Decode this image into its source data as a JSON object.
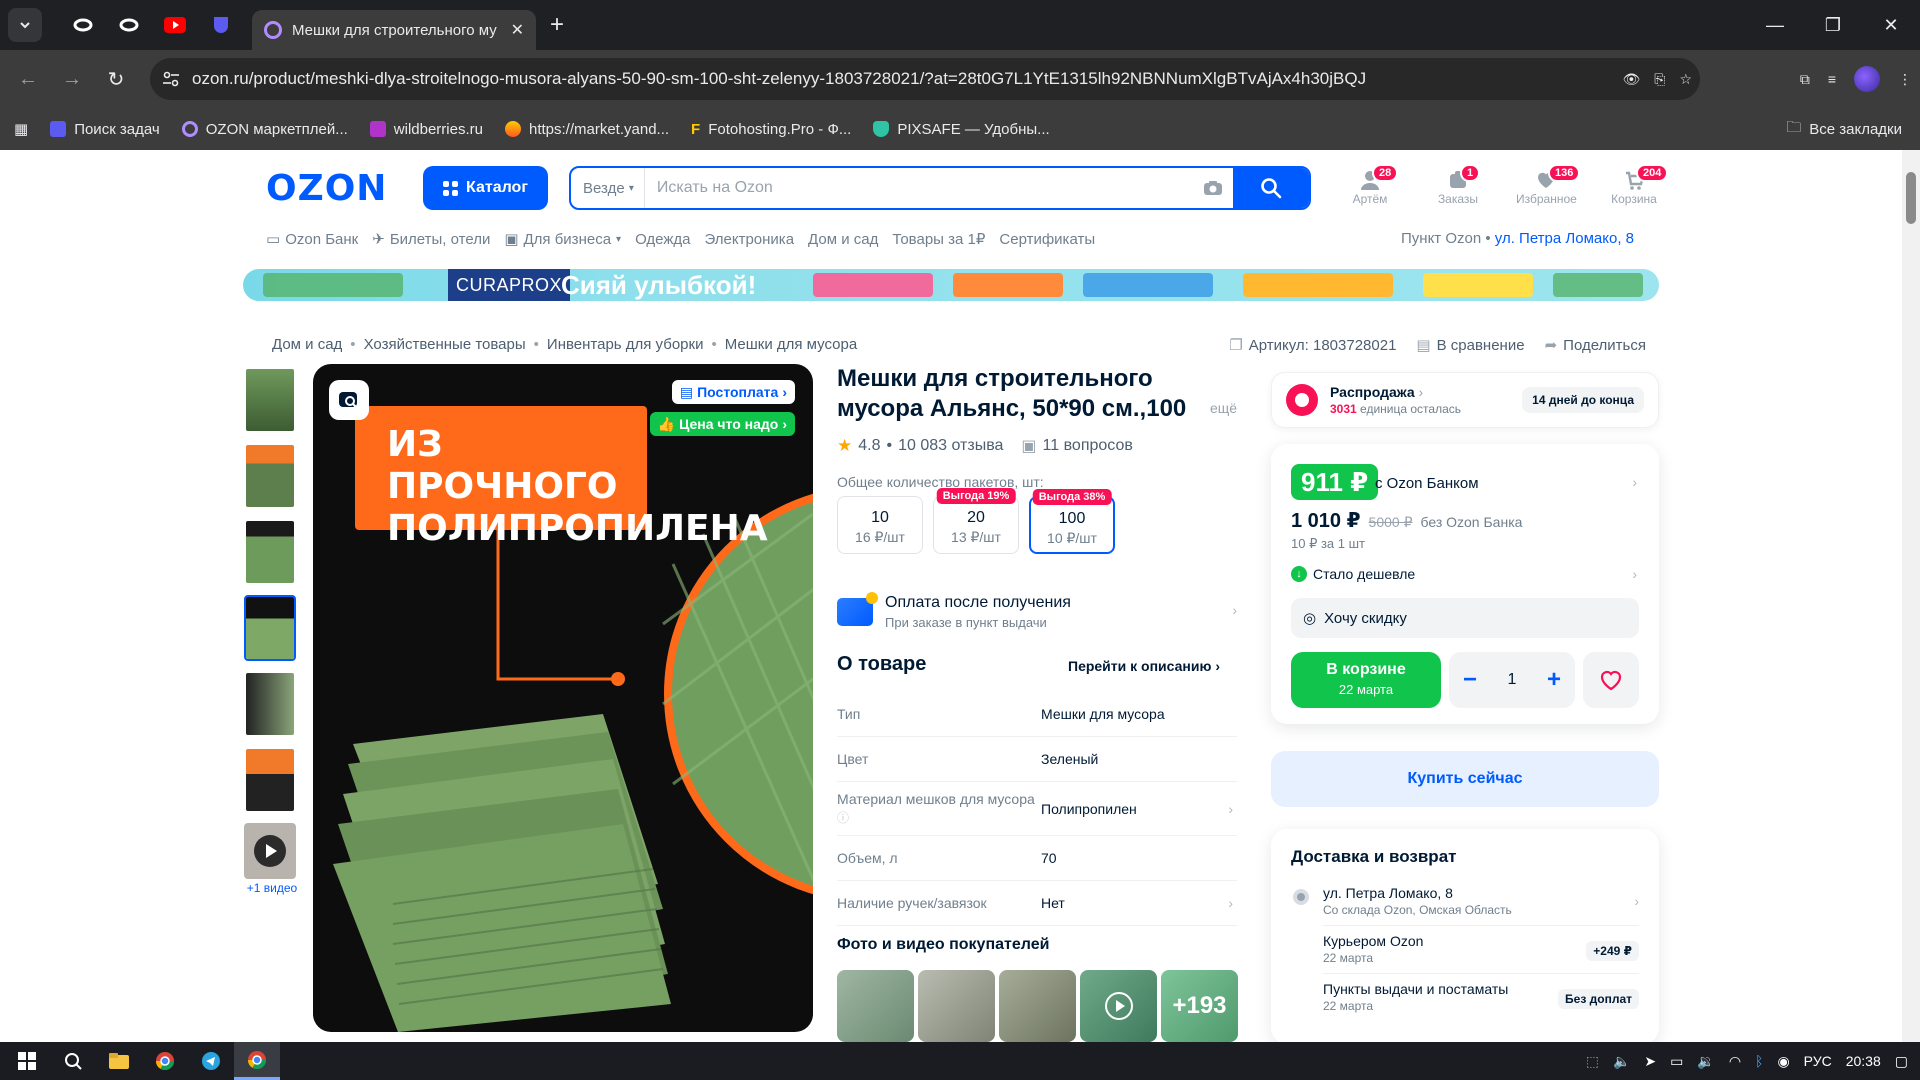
{
  "browser": {
    "active_tab_title": "Мешки для строительного му",
    "url": "ozon.ru/product/meshki-dlya-stroitelnogo-musora-alyans-50-90-sm-100-sht-zelenyy-1803728021/?at=28t0G7L1YtE1315lh92NBNNumXlgBTvAjAx4h30jBQJ",
    "bookmarks": [
      "Поиск задач",
      "OZON маркетплей...",
      "wildberries.ru",
      "https://market.yand...",
      "Fotohosting.Pro - Ф...",
      "PIXSAFE — Удобны..."
    ],
    "all_bookmarks": "Все закладки"
  },
  "header": {
    "logo": "OZON",
    "catalog": "Каталог",
    "search_scope": "Везде",
    "search_placeholder": "Искать на Ozon",
    "icons": [
      {
        "label": "Артём",
        "badge": "28"
      },
      {
        "label": "Заказы",
        "badge": "1"
      },
      {
        "label": "Избранное",
        "badge": "136"
      },
      {
        "label": "Корзина",
        "badge": "204"
      }
    ],
    "subnav": [
      "Ozon Банк",
      "Билеты, отели",
      "Для бизнеса",
      "Одежда",
      "Электроника",
      "Дом и сад",
      "Товары за 1₽",
      "Сертификаты"
    ],
    "pickup_label": "Пункт Ozon •",
    "pickup_address": "ул. Петра Ломако, 8"
  },
  "banner": {
    "brand": "CURAPROX",
    "slogan": "Сияй улыбкой!"
  },
  "breadcrumbs": [
    "Дом и сад",
    "Хозяйственные товары",
    "Инвентарь для уборки",
    "Мешки для мусора"
  ],
  "meta": {
    "article": "Артикул: 1803728021",
    "compare": "В сравнение",
    "share": "Поделиться"
  },
  "gallery": {
    "video_label": "+1 видео",
    "headline_line1": "ИЗ ПРОЧНОГО",
    "headline_line2": "ПОЛИПРОПИЛЕНА",
    "tag_postpay": "Постоплата",
    "tag_price": "Цена что надо"
  },
  "product": {
    "title": "Мешки для строительного мусора Альянс, 50*90 см.,100",
    "more": "ещё",
    "rating": "4.8",
    "reviews": "10 083 отзыва",
    "questions": "11 вопросов",
    "pack_label": "Общее количество пакетов, шт:",
    "packs": [
      {
        "qty": "10",
        "price": "16 ₽/шт",
        "gain": "",
        "selected": false
      },
      {
        "qty": "20",
        "price": "13 ₽/шт",
        "gain": "Выгода 19%",
        "selected": false
      },
      {
        "qty": "100",
        "price": "10 ₽/шт",
        "gain": "Выгода 38%",
        "selected": true
      }
    ],
    "pay_after_title": "Оплата после получения",
    "pay_after_sub": "При заказе в пункт выдачи",
    "about_title": "О товаре",
    "about_link": "Перейти к описанию",
    "specs": [
      {
        "k": "Тип",
        "v": "Мешки для мусора",
        "chev": false
      },
      {
        "k": "Цвет",
        "v": "Зеленый",
        "chev": false
      },
      {
        "k": "Материал мешков для мусора",
        "v": "Полипропилен",
        "chev": true
      },
      {
        "k": "Объем, л",
        "v": "70",
        "chev": false
      },
      {
        "k": "Наличие ручек/завязок",
        "v": "Нет",
        "chev": true
      }
    ],
    "ugc_title": "Фото и видео покупателей",
    "ugc_more": "+193"
  },
  "sale": {
    "title": "Распродажа",
    "count": "3031",
    "count_label": "единица осталась",
    "days": "14 дней до конца"
  },
  "price": {
    "ozon_bank_price": "911 ₽",
    "ozon_bank_label": "с Ozon Банком",
    "price": "1 010 ₽",
    "old_price": "5000 ₽",
    "no_bank_label": "без Ozon Банка",
    "per_unit": "10 ₽ за 1 шт",
    "cheaper": "Стало дешевле",
    "want_discount": "Хочу скидку",
    "in_cart": "В корзине",
    "in_cart_date": "22 марта",
    "qty": "1",
    "buy_now": "Купить сейчас"
  },
  "delivery": {
    "title": "Доставка и возврат",
    "rows": [
      {
        "a": "ул. Петра Ломако, 8",
        "b": "Со склада Ozon, Омская Область",
        "r": ""
      },
      {
        "a": "Курьером Ozon",
        "b": "22 марта",
        "r": "+249 ₽"
      },
      {
        "a": "Пункты выдачи и постаматы",
        "b": "22 марта",
        "r": "Без доплат"
      }
    ]
  },
  "taskbar": {
    "lang": "РУС",
    "time": "20:38"
  },
  "colors": {
    "ozon_blue": "#005bff",
    "green": "#10c44c",
    "pink": "#f91155"
  }
}
